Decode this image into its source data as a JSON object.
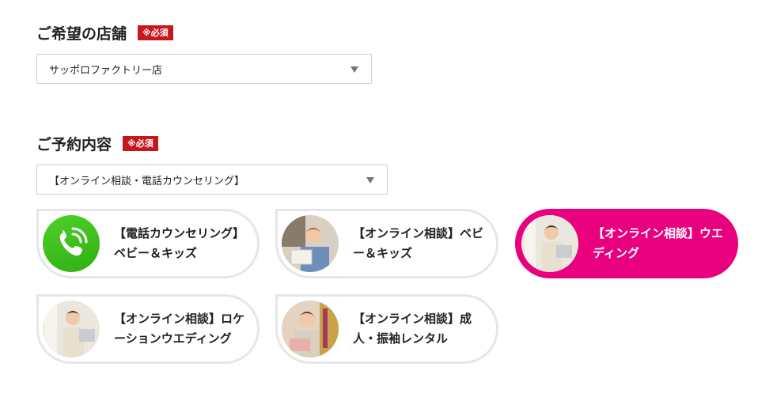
{
  "store_section": {
    "heading": "ご希望の店舗",
    "required_badge": "※必須",
    "select_value": "サッポロファクトリー店"
  },
  "reservation_section": {
    "heading": "ご予約内容",
    "required_badge": "※必須",
    "select_value": "【オンライン相談・電話カウンセリング】"
  },
  "options": [
    {
      "label": "【電話カウンセリング】ベビー＆キッズ",
      "icon": "phone-icon",
      "selected": false
    },
    {
      "label": "【オンライン相談】ベビー＆キッズ",
      "icon": "photo",
      "selected": false
    },
    {
      "label": "【オンライン相談】ウエディング",
      "icon": "photo",
      "selected": true
    },
    {
      "label": "【オンライン相談】ロケーションウエディング",
      "icon": "photo",
      "selected": false
    },
    {
      "label": "【オンライン相談】成人・振袖レンタル",
      "icon": "photo",
      "selected": false
    }
  ],
  "colors": {
    "badge": "#c8161d",
    "selected_option": "#e8007f",
    "phone_icon": "#3dc21b"
  }
}
